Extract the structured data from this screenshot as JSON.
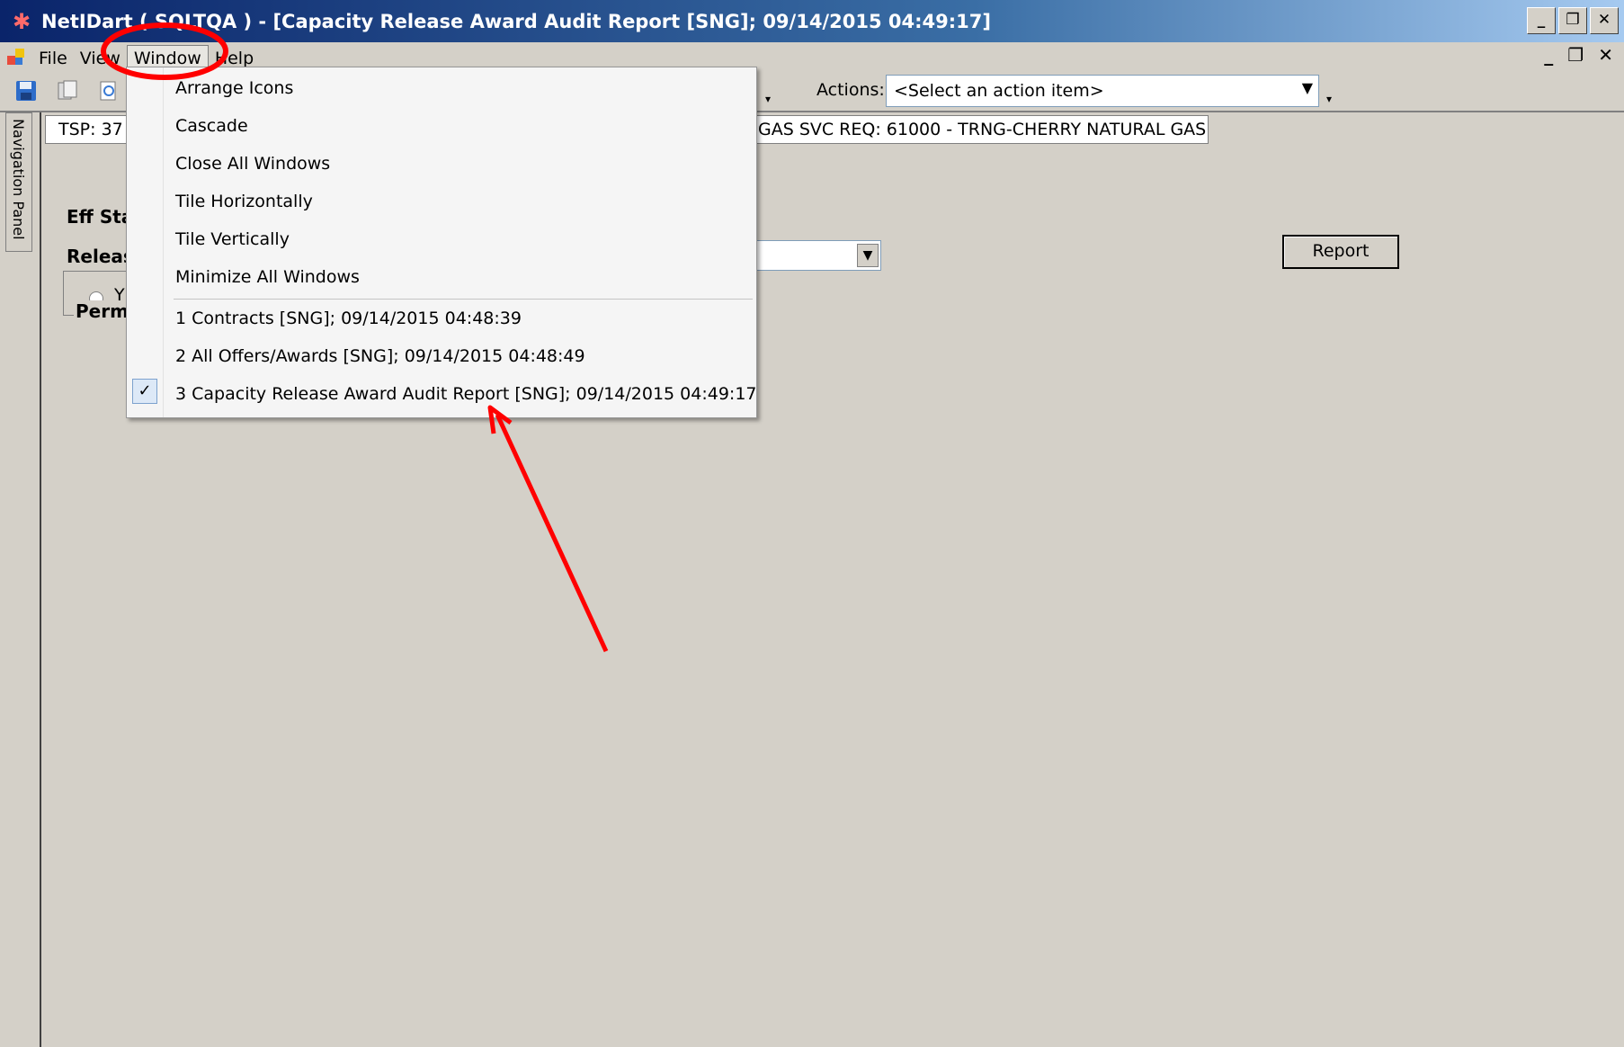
{
  "window": {
    "title": "NetIDart ( SQLTQA ) - [Capacity Release Award Audit Report [SNG]; 09/14/2015 04:49:17]",
    "controls": {
      "minimize": "_",
      "restore": "❐",
      "close": "✕"
    }
  },
  "menubar": {
    "items": [
      {
        "label": "File"
      },
      {
        "label": "View"
      },
      {
        "label": "Window",
        "open": true
      },
      {
        "label": "Help"
      }
    ],
    "mdi_controls": {
      "minimize": "_",
      "restore": "❐",
      "close": "✕"
    }
  },
  "toolbar": {
    "icons": [
      "save-icon",
      "copy-icon",
      "print-preview-icon"
    ],
    "actions_label": "Actions:",
    "actions_value": "<Select an action item>"
  },
  "content": {
    "nav_panel_label": "Navigation Panel",
    "info_bar": {
      "tsp_text": "TSP:  37",
      "svc_text": "GAS   SVC REQ:  61000 - TRNG-CHERRY NATURAL GAS"
    },
    "labels": {
      "eff_start": "Eff Sta",
      "release": "Releas",
      "permanent": "Perma",
      "radio_yes": "Y"
    },
    "report_button": "Report"
  },
  "window_menu": {
    "items": [
      {
        "label": "Arrange Icons"
      },
      {
        "label": "Cascade"
      },
      {
        "label": "Close All Windows"
      },
      {
        "label": "Tile Horizontally"
      },
      {
        "label": "Tile Vertically"
      },
      {
        "label": "Minimize All Windows"
      }
    ],
    "windows": [
      {
        "label": "1 Contracts [SNG]; 09/14/2015 04:48:39",
        "checked": false
      },
      {
        "label": "2 All Offers/Awards [SNG]; 09/14/2015 04:48:49",
        "checked": false
      },
      {
        "label": "3 Capacity Release Award Audit Report [SNG]; 09/14/2015 04:49:17",
        "checked": true
      }
    ],
    "check_glyph": "✓"
  },
  "annotations": {
    "highlight_color": "#ff0000",
    "circled_item": "Window",
    "arrow_target": "3 Capacity Release Award Audit Report [SNG]; 09/14/2015 04:49:17"
  }
}
